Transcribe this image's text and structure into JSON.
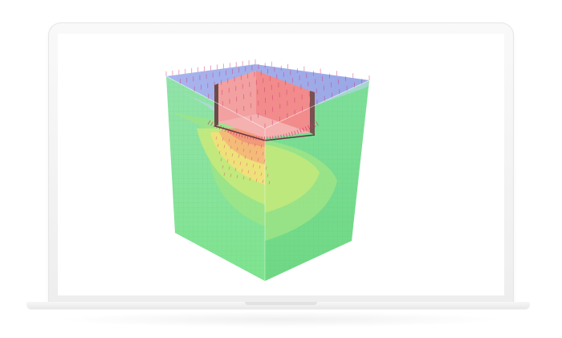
{
  "device": {
    "type": "laptop-mockup",
    "frame_color": "#f2f2f2",
    "screen_color": "#ffffff"
  },
  "visualization": {
    "kind": "3d-soil-block-contour",
    "colors": {
      "soil": "#7ee38e",
      "contour_mid": "#c9ea7a",
      "contour_high": "#f4e07a",
      "contour_peak": "#f3a878",
      "surface": "#9aa7e6",
      "structure": "#f28b8b",
      "arrows": "#d0356e",
      "mesh": "#57c878"
    }
  }
}
